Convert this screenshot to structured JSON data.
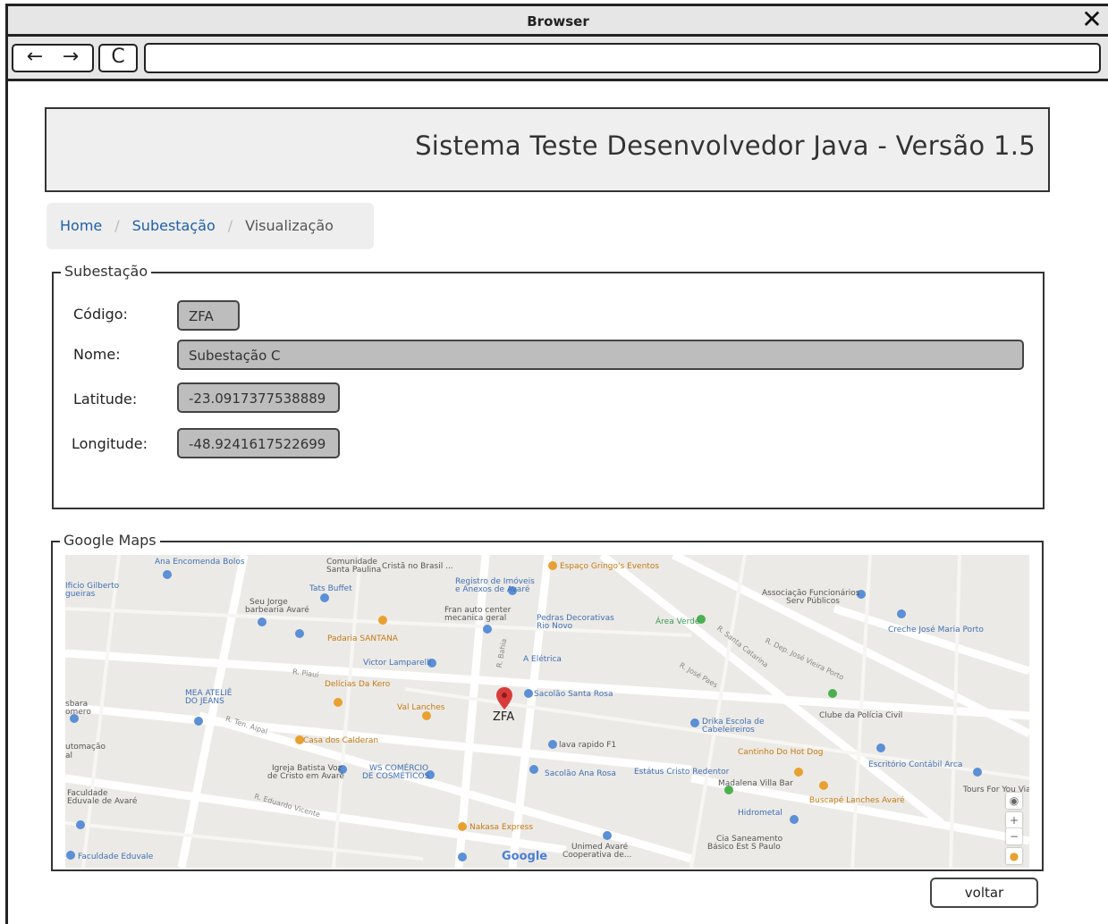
{
  "browser": {
    "title": "Browser",
    "back_symbol": "←",
    "forward_symbol": "→",
    "refresh_symbol": "C",
    "close_symbol": "✕",
    "address_value": ""
  },
  "header": {
    "title": "Sistema Teste Desenvolvedor Java -  Versão 1.5"
  },
  "breadcrumb": {
    "items": [
      {
        "label": "Home"
      },
      {
        "label": "Subestação"
      },
      {
        "label": "Visualização"
      }
    ],
    "separator": "/"
  },
  "subestacao": {
    "legend": "Subestação",
    "fields": [
      {
        "label": "Código:",
        "value": "ZFA"
      },
      {
        "label": "Nome:",
        "value": "Subestação C"
      },
      {
        "label": "Latitude:",
        "value": "-23.0917377538889"
      },
      {
        "label": "Longitude:",
        "value": "-48.9241617522699"
      }
    ]
  },
  "map_section": {
    "legend": "Google Maps",
    "marker_label": "ZFA",
    "google_logo": "Google",
    "zoom_in": "+",
    "zoom_out": "−",
    "places": [
      "Ana Encomenda Bolos",
      "Comunidade",
      "Santa Paulina",
      "Cristã no Brasil ...",
      "Registro de Imóveis",
      "e Anexos de Avaré",
      "Espaço Gringo's Eventos",
      "Associação Funcionários",
      "Serv Públicos",
      "Tats Buffet",
      "Seu Jorge",
      "barbearia Avaré",
      "Fran auto center",
      "mecanica geral",
      "Pedras Decorativas",
      "Rio Novo",
      "Área Verde",
      "Creche José Maria Porto",
      "Padaria SANTANA",
      "Victor Lamparelli",
      "A Elétrica",
      "Delícias Da Kero",
      "MEA ATELIÊ",
      "DO JEANS",
      "Val Lanches",
      "Sacolão Santa Rosa",
      "Drika Escola de",
      "Cabeleireiros",
      "Clube da Polícia Civil",
      "Casa dos Calderan",
      "lava rapido F1",
      "Cantinho Do Hot Dog",
      "Escritório Contábil Arca",
      "Igreja Batista Voz",
      "de Cristo em Avaré",
      "WS COMÉRCIO",
      "DE COSMÉTICOS",
      "Sacolão Ana Rosa",
      "Estátus Cristo Redentor",
      "Madalena Villa Bar",
      "Tours For You Via",
      "Faculdade",
      "Eduvale de Avaré",
      "Buscapé Lanches Avaré",
      "Hidrometal",
      "Nakasa Express",
      "Cia Saneamento",
      "Básico Est S Paulo",
      "Unimed Avaré",
      "Cooperativa de...",
      "Faculdade Eduvale",
      "Ificio Gilberto",
      "gueiras",
      "sbara",
      "omero",
      "utomação",
      "al"
    ],
    "streets": [
      "R. Bahia",
      "R. Piauí",
      "R. Ten. Aipal",
      "R. José Paes",
      "R. Santa Catarina",
      "R. Dep. José Vieira Porto",
      "R. Eduardo Vicente"
    ]
  },
  "actions": {
    "back_label": "voltar"
  },
  "colors": {
    "link": "#1e5fa8",
    "field_bg": "#bdbdbd",
    "banner_bg": "#efefef",
    "marker": "#d93b3b"
  }
}
